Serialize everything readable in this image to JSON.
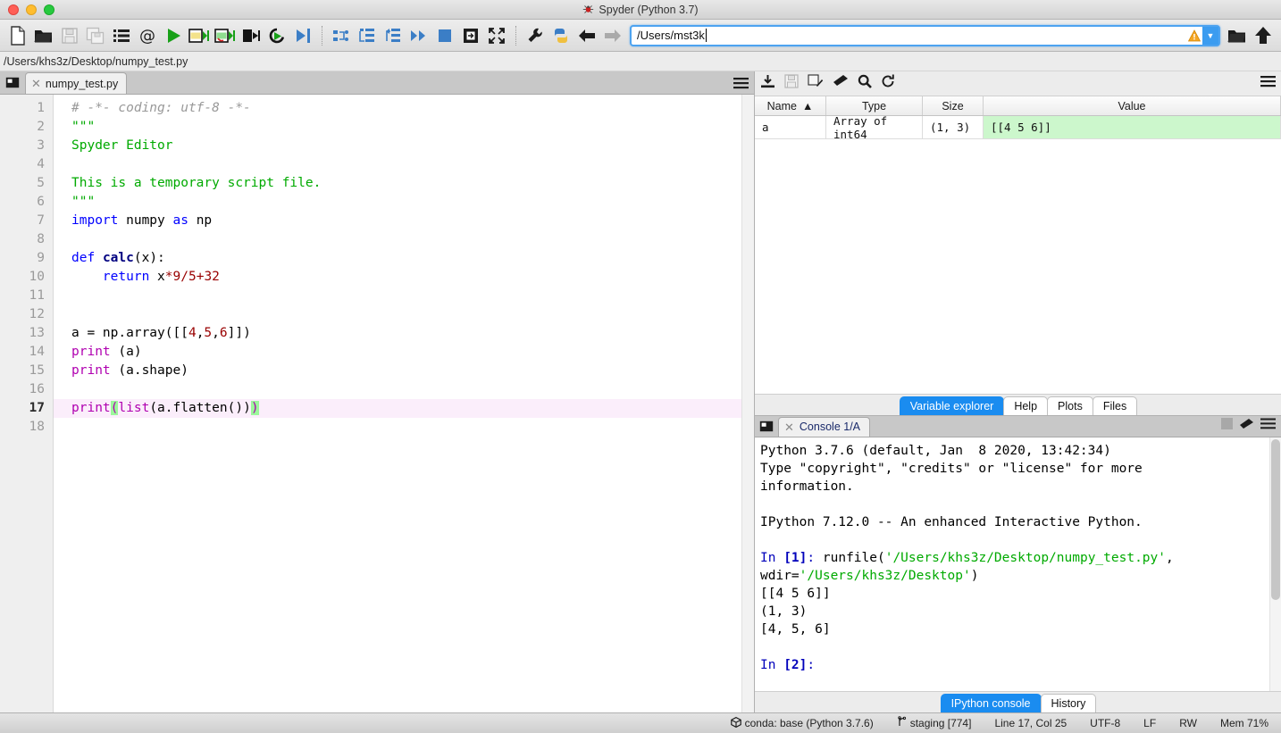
{
  "window": {
    "title": "Spyder (Python 3.7)",
    "logo_icon": "spider-logo"
  },
  "toolbar": {
    "buttons": [
      {
        "name": "new-file-button",
        "icon": "new-file-icon",
        "tooltip": "New file"
      },
      {
        "name": "open-file-button",
        "icon": "open-folder-icon",
        "tooltip": "Open file"
      },
      {
        "name": "save-file-button",
        "icon": "save-disk-icon",
        "tooltip": "Save file"
      },
      {
        "name": "save-all-button",
        "icon": "save-all-icon",
        "tooltip": "Save all"
      },
      {
        "name": "file-switcher-button",
        "icon": "list-icon",
        "tooltip": "File switcher"
      },
      {
        "name": "symbol-finder-button",
        "icon": "at-sign-icon",
        "tooltip": "Find symbols"
      },
      {
        "name": "run-file-button",
        "icon": "run-play-icon",
        "tooltip": "Run file"
      },
      {
        "name": "run-cell-button",
        "icon": "run-cell-icon",
        "tooltip": "Run cell"
      },
      {
        "name": "run-cell-advance-button",
        "icon": "run-cell-advance-icon",
        "tooltip": "Run cell and advance"
      },
      {
        "name": "run-selection-button",
        "icon": "run-selection-icon",
        "tooltip": "Run selection"
      },
      {
        "name": "rerun-button",
        "icon": "rerun-icon",
        "tooltip": "Re-run last cell"
      },
      {
        "name": "debug-file-button",
        "icon": "debug-icon",
        "tooltip": "Debug file"
      },
      {
        "name": "step-over-button",
        "icon": "step-over-icon",
        "tooltip": "Step over"
      },
      {
        "name": "step-into-button",
        "icon": "step-into-icon",
        "tooltip": "Step into"
      },
      {
        "name": "step-return-button",
        "icon": "step-return-icon",
        "tooltip": "Step return"
      },
      {
        "name": "continue-button",
        "icon": "continue-icon",
        "tooltip": "Continue"
      },
      {
        "name": "stop-debug-button",
        "icon": "stop-square-icon",
        "tooltip": "Stop debugging"
      },
      {
        "name": "debug-config-button",
        "icon": "debug-config-icon",
        "tooltip": "Configuration per file"
      },
      {
        "name": "maximize-pane-button",
        "icon": "maximize-arrows-icon",
        "tooltip": "Maximize current pane"
      },
      {
        "name": "preferences-button",
        "icon": "wrench-icon",
        "tooltip": "Preferences"
      },
      {
        "name": "pythonpath-button",
        "icon": "python-logo-icon",
        "tooltip": "PYTHONPATH manager"
      },
      {
        "name": "back-button",
        "icon": "arrow-left-icon",
        "tooltip": "Back"
      },
      {
        "name": "forward-button",
        "icon": "arrow-right-icon",
        "tooltip": "Forward"
      }
    ],
    "path": {
      "value": "/Users/mst3k",
      "warning_icon": "warning-triangle-icon",
      "dropdown_icon": "chevron-down-icon"
    },
    "browse_button": {
      "name": "browse-directory-button",
      "icon": "open-folder-icon"
    },
    "parent_button": {
      "name": "parent-directory-button",
      "icon": "arrow-up-icon"
    }
  },
  "editor": {
    "file_path": "/Users/khs3z/Desktop/numpy_test.py",
    "pane_icon": "browse-tabs-icon",
    "options_icon": "hamburger-menu-icon",
    "tab": {
      "label": "numpy_test.py",
      "close_icon": "close-icon"
    },
    "line_numbers": [
      "1",
      "2",
      "3",
      "4",
      "5",
      "6",
      "7",
      "8",
      "9",
      "10",
      "11",
      "12",
      "13",
      "14",
      "15",
      "16",
      "17",
      "18"
    ],
    "current_line": 17,
    "lines": [
      {
        "n": 1,
        "tokens": [
          {
            "t": "# -*- coding: utf-8 -*-",
            "c": "tok-com"
          }
        ]
      },
      {
        "n": 2,
        "tokens": [
          {
            "t": "\"\"\"",
            "c": "tok-str"
          }
        ]
      },
      {
        "n": 3,
        "tokens": [
          {
            "t": "Spyder Editor",
            "c": "tok-str"
          }
        ]
      },
      {
        "n": 4,
        "tokens": []
      },
      {
        "n": 5,
        "tokens": [
          {
            "t": "This is a temporary script file.",
            "c": "tok-str"
          }
        ]
      },
      {
        "n": 6,
        "tokens": [
          {
            "t": "\"\"\"",
            "c": "tok-str"
          }
        ]
      },
      {
        "n": 7,
        "tokens": [
          {
            "t": "import",
            "c": "tok-kw"
          },
          {
            "t": " numpy ",
            "c": "tok-plain"
          },
          {
            "t": "as",
            "c": "tok-kw"
          },
          {
            "t": " np",
            "c": "tok-plain"
          }
        ]
      },
      {
        "n": 8,
        "tokens": []
      },
      {
        "n": 9,
        "tokens": [
          {
            "t": "def",
            "c": "tok-def"
          },
          {
            "t": " ",
            "c": "tok-plain"
          },
          {
            "t": "calc",
            "c": "tok-fn"
          },
          {
            "t": "(x):",
            "c": "tok-plain"
          }
        ]
      },
      {
        "n": 10,
        "tokens": [
          {
            "t": "    ",
            "c": "tok-plain"
          },
          {
            "t": "return",
            "c": "tok-kw"
          },
          {
            "t": " x",
            "c": "tok-plain"
          },
          {
            "t": "*",
            "c": "tok-op"
          },
          {
            "t": "9",
            "c": "tok-num"
          },
          {
            "t": "/",
            "c": "tok-op"
          },
          {
            "t": "5",
            "c": "tok-num"
          },
          {
            "t": "+",
            "c": "tok-op"
          },
          {
            "t": "32",
            "c": "tok-num"
          }
        ]
      },
      {
        "n": 11,
        "tokens": []
      },
      {
        "n": 12,
        "tokens": []
      },
      {
        "n": 13,
        "tokens": [
          {
            "t": "a = np.array([[",
            "c": "tok-plain"
          },
          {
            "t": "4",
            "c": "tok-num"
          },
          {
            "t": ",",
            "c": "tok-plain"
          },
          {
            "t": "5",
            "c": "tok-num"
          },
          {
            "t": ",",
            "c": "tok-plain"
          },
          {
            "t": "6",
            "c": "tok-num"
          },
          {
            "t": "]])",
            "c": "tok-plain"
          }
        ]
      },
      {
        "n": 14,
        "tokens": [
          {
            "t": "print",
            "c": "tok-bi"
          },
          {
            "t": " (a)",
            "c": "tok-plain"
          }
        ]
      },
      {
        "n": 15,
        "tokens": [
          {
            "t": "print",
            "c": "tok-bi"
          },
          {
            "t": " (a.shape)",
            "c": "tok-plain"
          }
        ]
      },
      {
        "n": 16,
        "tokens": []
      },
      {
        "n": 17,
        "tokens": [
          {
            "t": "print",
            "c": "tok-bi"
          },
          {
            "t": "(",
            "c": "paren-match"
          },
          {
            "t": "list",
            "c": "tok-bi"
          },
          {
            "t": "(a.flatten())",
            "c": "tok-plain"
          },
          {
            "t": ")",
            "c": "paren-match"
          }
        ]
      },
      {
        "n": 18,
        "tokens": []
      }
    ]
  },
  "variable_explorer": {
    "toolbar_icons": [
      {
        "name": "import-data-button",
        "icon": "import-data-icon"
      },
      {
        "name": "save-data-button",
        "icon": "save-disk-icon"
      },
      {
        "name": "save-data-as-button",
        "icon": "save-as-icon"
      },
      {
        "name": "remove-all-variables-button",
        "icon": "eraser-icon"
      },
      {
        "name": "search-variables-button",
        "icon": "search-icon"
      },
      {
        "name": "refresh-variables-button",
        "icon": "refresh-icon"
      },
      {
        "name": "variable-explorer-options-button",
        "icon": "hamburger-menu-icon"
      }
    ],
    "columns": [
      "Name",
      "Type",
      "Size",
      "Value"
    ],
    "sort_column": "Name",
    "sort_icon": "sort-ascending-icon",
    "rows": [
      {
        "name": "a",
        "type": "Array of int64",
        "size": "(1, 3)",
        "value": "[[4 5 6]]"
      }
    ]
  },
  "right_tabs": {
    "items": [
      "Variable explorer",
      "Help",
      "Plots",
      "Files"
    ],
    "active": "Variable explorer"
  },
  "console": {
    "pane_icon": "browse-tabs-icon",
    "tab": {
      "label": "Console 1/A",
      "close_icon": "close-icon"
    },
    "header_icons": [
      {
        "name": "stop-console-button",
        "icon": "stop-square-icon"
      },
      {
        "name": "clear-console-button",
        "icon": "eraser-icon"
      },
      {
        "name": "console-options-button",
        "icon": "hamburger-menu-icon"
      }
    ],
    "lines": [
      [
        {
          "t": "Python 3.7.6 (default, Jan  8 2020, 13:42:34)",
          "c": "con-black"
        }
      ],
      [
        {
          "t": "Type \"copyright\", \"credits\" or \"license\" for more",
          "c": "con-black"
        }
      ],
      [
        {
          "t": "information.",
          "c": "con-black"
        }
      ],
      [],
      [
        {
          "t": "IPython 7.12.0 -- An enhanced Interactive Python.",
          "c": "con-black"
        }
      ],
      [],
      [
        {
          "t": "In ",
          "c": "con-blue"
        },
        {
          "t": "[1]",
          "c": "con-bnum"
        },
        {
          "t": ": ",
          "c": "con-blue"
        },
        {
          "t": "runfile(",
          "c": "con-black"
        },
        {
          "t": "'/Users/khs3z/Desktop/numpy_test.py'",
          "c": "con-green"
        },
        {
          "t": ",",
          "c": "con-black"
        }
      ],
      [
        {
          "t": "wdir=",
          "c": "con-black"
        },
        {
          "t": "'/Users/khs3z/Desktop'",
          "c": "con-green"
        },
        {
          "t": ")",
          "c": "con-black"
        }
      ],
      [
        {
          "t": "[[4 5 6]]",
          "c": "con-black"
        }
      ],
      [
        {
          "t": "(1, 3)",
          "c": "con-black"
        }
      ],
      [
        {
          "t": "[4, 5, 6]",
          "c": "con-black"
        }
      ],
      [],
      [
        {
          "t": "In ",
          "c": "con-blue"
        },
        {
          "t": "[2]",
          "c": "con-bnum"
        },
        {
          "t": ":",
          "c": "con-blue"
        }
      ]
    ]
  },
  "bottom_tabs": {
    "items": [
      "IPython console",
      "History"
    ],
    "active": "IPython console"
  },
  "status_bar": {
    "conda_icon": "package-icon",
    "conda": "conda: base (Python 3.7.6)",
    "branch_icon": "git-branch-icon",
    "branch": "staging [774]",
    "cursor": "Line 17, Col 25",
    "encoding": "UTF-8",
    "eol": "LF",
    "permissions": "RW",
    "memory": "Mem 71%"
  },
  "colors": {
    "accent_blue": "#1a8cf0",
    "string_green": "#00aa00",
    "keyword_blue": "#0000ff",
    "builtin_purple": "#b000b0",
    "number_red": "#990000",
    "current_line": "#fbeefb",
    "value_cell_green": "#ccf7cc"
  }
}
